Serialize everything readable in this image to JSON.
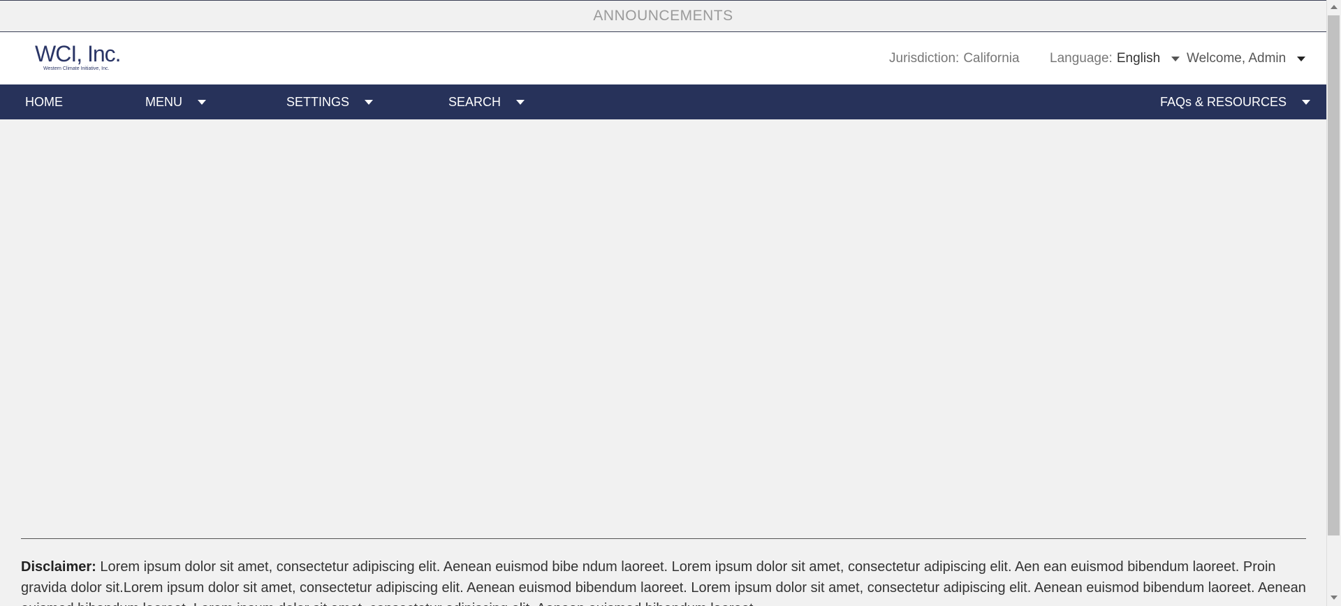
{
  "announcement": {
    "label": "ANNOUNCEMENTS"
  },
  "logo": {
    "name": "WCI, Inc.",
    "tagline": "Western Climate Initiative, Inc."
  },
  "header": {
    "jurisdiction_label": "Jurisdiction:",
    "jurisdiction_value": "California",
    "language_label": "Language:",
    "language_value": "English",
    "welcome": "Welcome, Admin"
  },
  "nav": {
    "home": "HOME",
    "menu": "MENU",
    "settings": "SETTINGS",
    "search": "SEARCH",
    "faq": "FAQs & RESOURCES"
  },
  "disclaimer": {
    "label": "Disclaimer:",
    "text": "Lorem ipsum dolor sit amet, consectetur adipiscing elit. Aenean euismod bibe ndum laoreet. Lorem ipsum dolor sit amet, consectetur adipiscing elit. Aen ean euismod bibendum laoreet. Proin gravida dolor sit.Lorem ipsum dolor sit amet, consectetur adipiscing elit. Aenean euismod bibendum laoreet. Lorem ipsum dolor sit amet, consectetur adipiscing elit. Aenean euismod bibendum laoreet. Aenean euismod bibendum laoreet. Lorem ipsum dolor sit amet, consectetur adipiscing elit. Aenean euismod bibendum laoreet."
  },
  "colors": {
    "nav_bg": "#27325a",
    "logo_green": "#14834a",
    "logo_navy": "#2a3566"
  }
}
